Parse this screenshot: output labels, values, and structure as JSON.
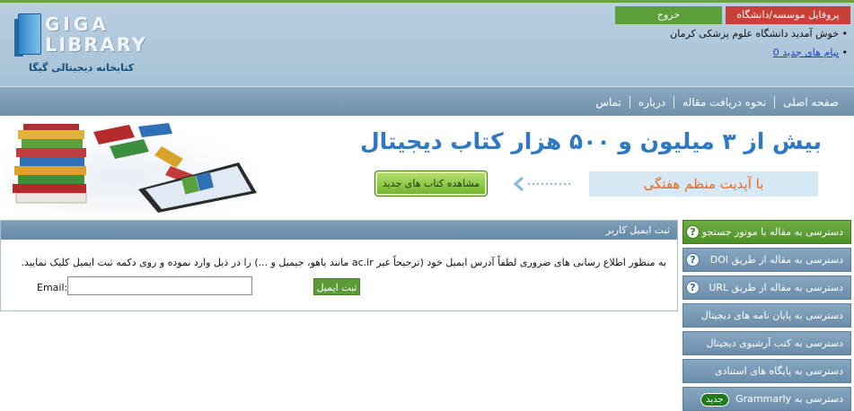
{
  "header": {
    "logo_title_1": "GIGA",
    "logo_title_2": "LIBRARY",
    "logo_persian": "کتابخانه دیجیتالی گیگا",
    "profile_button": "پروفایل موسسه/دانشگاه",
    "logout_button": "خروج",
    "welcome_text": "• خوش آمدید دانشگاه علوم پزشکی کرمان",
    "new_messages_text": "پیام های جدید 0",
    "bullet": "•"
  },
  "nav": {
    "items": [
      "صفحه اصلی",
      "نحوه دریافت مقاله",
      "درباره",
      "تماس"
    ]
  },
  "banner": {
    "title": "بیش از ۳ میلیون و ۵۰۰ هزار کتاب دیجیتال",
    "subtitle": "با آپدیت منظم هفتگی",
    "view_new_books_button": "مشاهده کتاب های جدید",
    "colors": {
      "title": "#2f78c4",
      "subtitle": "#e76a1c",
      "button": "#6fb32e"
    }
  },
  "email_panel": {
    "header": "ثبت ایمیل کاربر",
    "description": "به منظور اطلاع رسانی های ضروری لطفاً آدرس ایمیل خود (ترجیحاً غیر ac.ir مانند یاهو، جیمیل و ...) را در ذیل وارد نموده و روی دکمه ثبت ایمیل کلیک نمایید.",
    "email_label": "Email:",
    "email_value": "",
    "submit_button": "ثبت ایمیل"
  },
  "sidebar": {
    "help_icon_glyph": "?",
    "items": [
      {
        "label": "دسترسی به مقاله با موتور جستجو",
        "icon": "help-icon"
      },
      {
        "label": "دسترسی به مقاله از طریق DOI",
        "icon": "help-icon"
      },
      {
        "label": "دسترسی به مقاله از طریق URL",
        "icon": "help-icon"
      },
      {
        "label": "دسترسی به پایان نامه های دیجیتال"
      },
      {
        "label": "دسترسی به کتب آرشیوی دیجیتال"
      },
      {
        "label": "دسترسی به پایگاه های استنادی"
      },
      {
        "label": "دسترسی به Grammarly",
        "badge": "جدید"
      }
    ]
  }
}
